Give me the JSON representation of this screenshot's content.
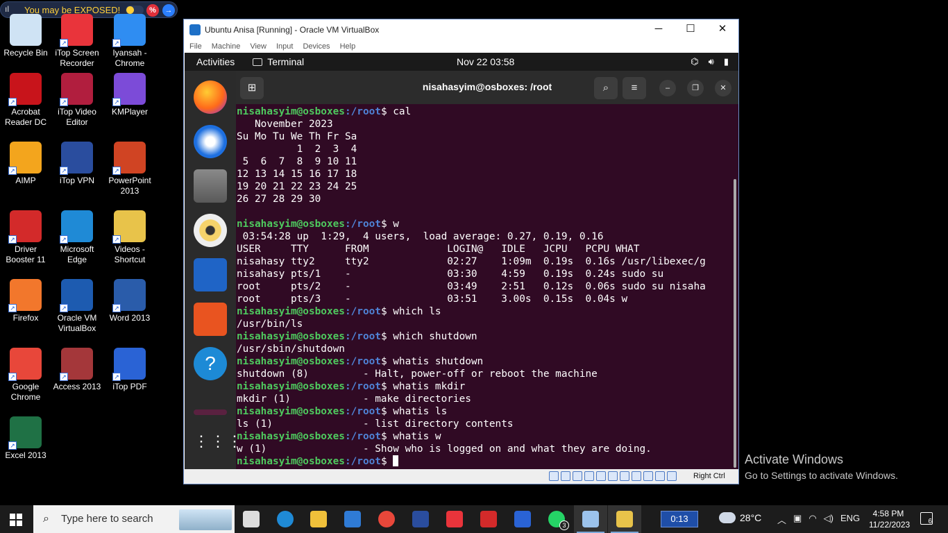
{
  "banner": {
    "text": "You may be EXPOSED!",
    "percent": "%",
    "arrow": "→"
  },
  "desktop": {
    "icons": [
      {
        "label": "Recycle Bin",
        "color": "#cfe3f4"
      },
      {
        "label": "iTop Screen Recorder",
        "color": "#e9343b"
      },
      {
        "label": "Iyansah - Chrome",
        "color": "#2f8df2"
      },
      {
        "label": "Acrobat Reader DC",
        "color": "#c8141b"
      },
      {
        "label": "iTop Video Editor",
        "color": "#b11e3e"
      },
      {
        "label": "KMPlayer",
        "color": "#7c4bd8"
      },
      {
        "label": "AIMP",
        "color": "#f3a51d"
      },
      {
        "label": "iTop VPN",
        "color": "#2a4d9e"
      },
      {
        "label": "PowerPoint 2013",
        "color": "#d04423"
      },
      {
        "label": "Driver Booster 11",
        "color": "#d32a2a"
      },
      {
        "label": "Microsoft Edge",
        "color": "#1f8ad6"
      },
      {
        "label": "Videos - Shortcut",
        "color": "#e8c34a"
      },
      {
        "label": "Firefox",
        "color": "#f2772c"
      },
      {
        "label": "Oracle VM VirtualBox",
        "color": "#1d5bb0"
      },
      {
        "label": "Word 2013",
        "color": "#2a5caa"
      },
      {
        "label": "Google Chrome",
        "color": "#e8473a"
      },
      {
        "label": "Access 2013",
        "color": "#a4373a"
      },
      {
        "label": "iTop PDF",
        "color": "#2a63d5"
      },
      {
        "label": "Excel 2013",
        "color": "#1f7145"
      }
    ]
  },
  "vbox": {
    "title": "Ubuntu Anisa [Running] - Oracle VM VirtualBox",
    "menu": [
      "File",
      "Machine",
      "View",
      "Input",
      "Devices",
      "Help"
    ],
    "status_right": "Right Ctrl"
  },
  "ubuntu": {
    "activities": "Activities",
    "app_menu": "Terminal",
    "clock": "Nov 22  03:58"
  },
  "terminal": {
    "title": "nisahasyim@osboxes: /root",
    "user": "nisahasyim@osboxes",
    "path": ":/root",
    "prompt_char": "$ ",
    "lines": [
      {
        "type": "cmd",
        "cmd": "cal"
      },
      {
        "type": "out",
        "text": "   November 2023"
      },
      {
        "type": "out",
        "text": "Su Mo Tu We Th Fr Sa"
      },
      {
        "type": "out",
        "text": "          1  2  3  4"
      },
      {
        "type": "out",
        "text": " 5  6  7  8  9 10 11"
      },
      {
        "type": "out",
        "text": "12 13 14 15 16 17 18"
      },
      {
        "type": "out",
        "text": "19 20 21 22 23 24 25"
      },
      {
        "type": "out",
        "text": "26 27 28 29 30"
      },
      {
        "type": "out",
        "text": ""
      },
      {
        "type": "cmd",
        "cmd": "w"
      },
      {
        "type": "out",
        "text": " 03:54:28 up  1:29,  4 users,  load average: 0.27, 0.19, 0.16"
      },
      {
        "type": "out",
        "text": "USER     TTY      FROM             LOGIN@   IDLE   JCPU   PCPU WHAT"
      },
      {
        "type": "out",
        "text": "nisahasy tty2     tty2             02:27    1:09m  0.19s  0.16s /usr/libexec/g"
      },
      {
        "type": "out",
        "text": "nisahasy pts/1    -                03:30    4:59   0.19s  0.24s sudo su"
      },
      {
        "type": "out",
        "text": "root     pts/2    -                03:49    2:51   0.12s  0.06s sudo su nisaha"
      },
      {
        "type": "out",
        "text": "root     pts/3    -                03:51    3.00s  0.15s  0.04s w"
      },
      {
        "type": "cmd",
        "cmd": "which ls"
      },
      {
        "type": "out",
        "text": "/usr/bin/ls"
      },
      {
        "type": "cmd",
        "cmd": "which shutdown"
      },
      {
        "type": "out",
        "text": "/usr/sbin/shutdown"
      },
      {
        "type": "cmd",
        "cmd": "whatis shutdown"
      },
      {
        "type": "out",
        "text": "shutdown (8)         - Halt, power-off or reboot the machine"
      },
      {
        "type": "cmd",
        "cmd": "whatis mkdir"
      },
      {
        "type": "out",
        "text": "mkdir (1)            - make directories"
      },
      {
        "type": "cmd",
        "cmd": "whatis ls"
      },
      {
        "type": "out",
        "text": "ls (1)               - list directory contents"
      },
      {
        "type": "cmd",
        "cmd": "whatis w"
      },
      {
        "type": "out",
        "text": "w (1)                - Show who is logged on and what they are doing."
      },
      {
        "type": "prompt",
        "cmd": ""
      }
    ]
  },
  "activation": {
    "line1": "Activate Windows",
    "line2": "Go to Settings to activate Windows."
  },
  "taskbar": {
    "search_placeholder": "Type here to search",
    "timer": "0:13",
    "weather": "28°C",
    "lang": "ENG",
    "time": "4:58 PM",
    "date": "11/22/2023",
    "notifications": "6",
    "whatsapp_badge": "3",
    "apps": [
      {
        "name": "task-view",
        "color": "#dddddd"
      },
      {
        "name": "edge",
        "color": "#1f8ad6"
      },
      {
        "name": "file-explorer",
        "color": "#f0c03a"
      },
      {
        "name": "mail",
        "color": "#2f7bd6"
      },
      {
        "name": "chrome",
        "color": "#e8473a"
      },
      {
        "name": "itop-vpn",
        "color": "#2a4d9e"
      },
      {
        "name": "itop-screen-recorder",
        "color": "#e9343b"
      },
      {
        "name": "driver-booster",
        "color": "#d32a2a"
      },
      {
        "name": "itop-pdf",
        "color": "#2a63d5"
      },
      {
        "name": "whatsapp",
        "color": "#25d366"
      },
      {
        "name": "virtualbox",
        "color": "#9cc3ec"
      },
      {
        "name": "videos",
        "color": "#e8c34a"
      }
    ]
  }
}
